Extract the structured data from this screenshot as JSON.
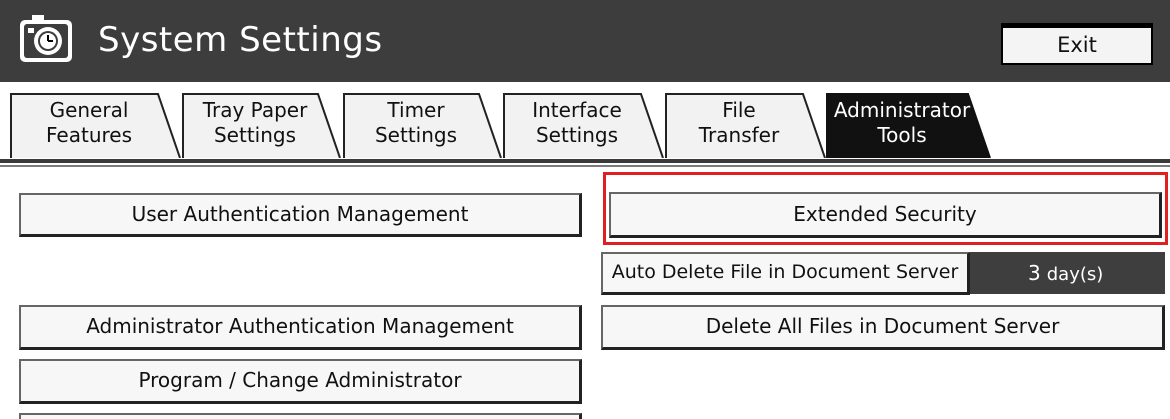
{
  "header": {
    "title": "System Settings",
    "exit_label": "Exit",
    "icon": "settings-clock-icon"
  },
  "tabs": [
    {
      "line1": "General",
      "line2": "Features",
      "active": false
    },
    {
      "line1": "Tray Paper",
      "line2": "Settings",
      "active": false
    },
    {
      "line1": "Timer",
      "line2": "Settings",
      "active": false
    },
    {
      "line1": "Interface",
      "line2": "Settings",
      "active": false
    },
    {
      "line1": "File",
      "line2": "Transfer",
      "active": false
    },
    {
      "line1": "Administrator",
      "line2": "Tools",
      "active": true
    }
  ],
  "buttons": {
    "user_auth": "User Authentication Management",
    "extended_security": "Extended Security",
    "auto_delete": "Auto Delete File in Document Server",
    "auto_delete_value": "3",
    "auto_delete_unit": "day(s)",
    "admin_auth": "Administrator Authentication Management",
    "delete_all": "Delete All Files in Document Server",
    "program_admin": "Program / Change Administrator"
  },
  "colors": {
    "titlebar": "#3d3d3d",
    "active_tab": "#111111",
    "highlight": "#e02020"
  }
}
